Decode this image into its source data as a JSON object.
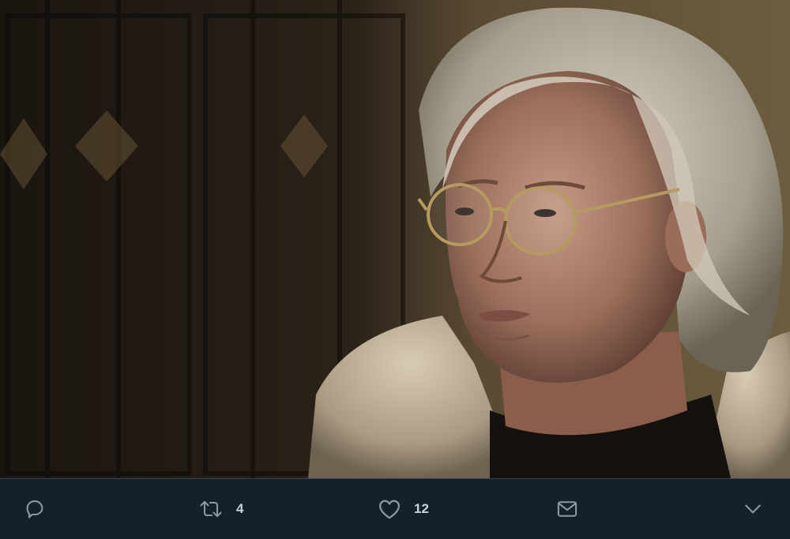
{
  "tweet": {
    "media": {
      "alt_icon": "photo"
    },
    "actions": {
      "reply": {
        "icon": "reply-icon",
        "count": ""
      },
      "retweet": {
        "icon": "retweet-icon",
        "count": "4"
      },
      "like": {
        "icon": "heart-icon",
        "count": "12"
      },
      "dm": {
        "icon": "envelope-icon"
      },
      "more": {
        "icon": "chevron-down-icon"
      }
    }
  },
  "colors": {
    "background": "#15202b",
    "icon": "#8899a6",
    "count_text": "#c9d3db",
    "divider": "#38444d"
  }
}
